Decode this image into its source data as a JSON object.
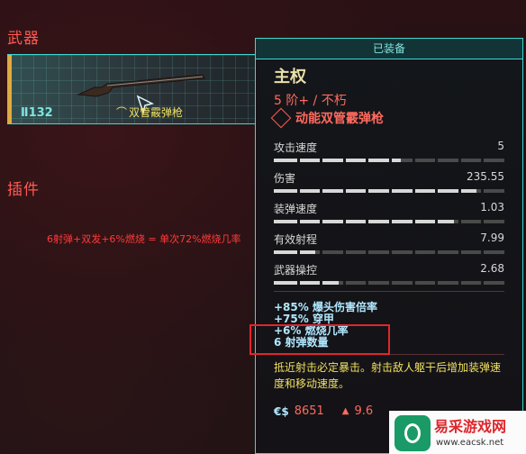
{
  "sections": {
    "weapons": "武器",
    "mods": "插件"
  },
  "weapon_card": {
    "level": "132",
    "name": "双管霰弹枪"
  },
  "annotation": "6射弹+双发+6%燃烧 = 单次72%燃烧几率",
  "panel": {
    "header": "已装备",
    "type": "主权",
    "tier": "5 阶+ / 不朽",
    "name": "动能双管霰弹枪",
    "stats": [
      {
        "label": "攻击速度",
        "value": "5",
        "fill": 0.55
      },
      {
        "label": "伤害",
        "value": "235.55",
        "fill": 0.88
      },
      {
        "label": "装弹速度",
        "value": "1.03",
        "fill": 0.78
      },
      {
        "label": "有效射程",
        "value": "7.99",
        "fill": 0.18
      },
      {
        "label": "武器操控",
        "value": "2.68",
        "fill": 0.28
      }
    ],
    "effects": [
      "+85% 爆头伤害倍率",
      "+75% 穿甲",
      "+6% 燃烧几率",
      "6 射弹数量"
    ],
    "description": "抵近射击必定暴击。射击敌人躯干后增加装弹速度和移动速度。",
    "price_icon": "€$",
    "price": "8651",
    "weight": "9.6"
  },
  "logo": {
    "title": "易采游戏网",
    "url": "www.eacsk.net"
  },
  "colors": {
    "accent_cyan": "#3fd8d0",
    "accent_red": "#ff5a52",
    "highlight_box": "#e0262c",
    "effect_text": "#b0e8ff",
    "description_text": "#f0e060"
  }
}
